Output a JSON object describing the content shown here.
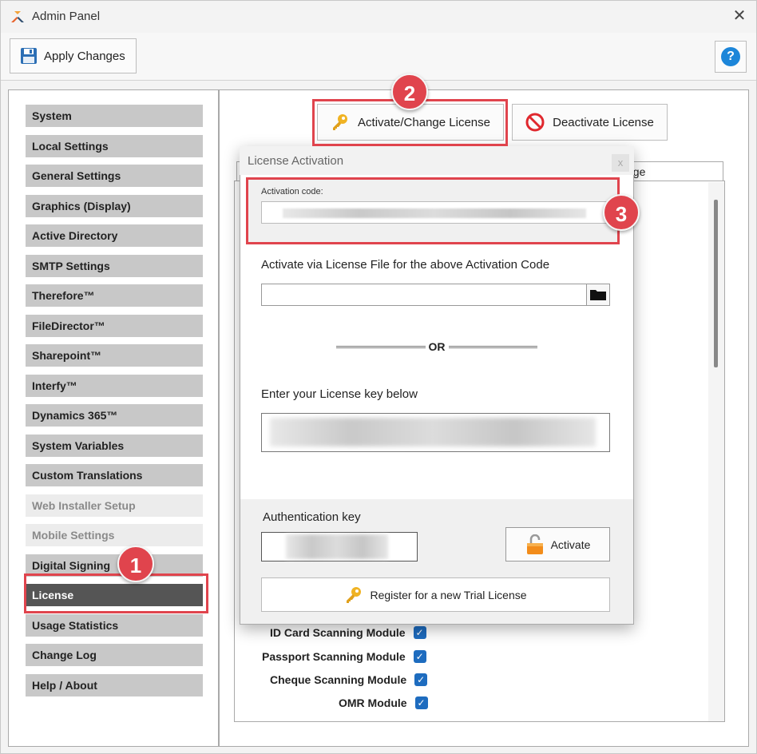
{
  "window": {
    "title": "Admin Panel",
    "close_glyph": "✕"
  },
  "toolbar": {
    "apply_label": "Apply Changes",
    "help_glyph": "?"
  },
  "sidebar": {
    "items": [
      {
        "label": "System",
        "state": "normal"
      },
      {
        "label": "Local Settings",
        "state": "normal"
      },
      {
        "label": "General Settings",
        "state": "normal"
      },
      {
        "label": "Graphics (Display)",
        "state": "normal"
      },
      {
        "label": "Active Directory",
        "state": "normal"
      },
      {
        "label": "SMTP Settings",
        "state": "normal"
      },
      {
        "label": "Therefore™",
        "state": "normal"
      },
      {
        "label": "FileDirector™",
        "state": "normal"
      },
      {
        "label": "Sharepoint™",
        "state": "normal"
      },
      {
        "label": "Interfy™",
        "state": "normal"
      },
      {
        "label": "Dynamics 365™",
        "state": "normal"
      },
      {
        "label": "System Variables",
        "state": "normal"
      },
      {
        "label": "Custom Translations",
        "state": "normal"
      },
      {
        "label": "Web Installer Setup",
        "state": "disabled"
      },
      {
        "label": "Mobile Settings",
        "state": "disabled"
      },
      {
        "label": "Digital Signing",
        "state": "normal"
      },
      {
        "label": "License",
        "state": "active"
      },
      {
        "label": "Usage Statistics",
        "state": "normal"
      },
      {
        "label": "Change Log",
        "state": "normal"
      },
      {
        "label": "Help / About",
        "state": "normal"
      }
    ]
  },
  "license_page": {
    "activate_label": "Activate/Change License",
    "deactivate_label": "Deactivate License",
    "list_header_partial": "age",
    "modules": [
      {
        "label": "ID Card Scanning Module",
        "checked": true
      },
      {
        "label": "Passport Scanning Module",
        "checked": true
      },
      {
        "label": "Cheque Scanning Module",
        "checked": true
      },
      {
        "label": "OMR Module",
        "checked": true
      }
    ]
  },
  "badges": {
    "step1": "1",
    "step2": "2",
    "step3": "3"
  },
  "dialog": {
    "title": "License Activation",
    "close_glyph": "x",
    "activation_code_label": "Activation code:",
    "license_file_label": "Activate via License File for the above Activation Code",
    "or_text": "OR",
    "license_key_label": "Enter your License key below",
    "auth_key_label": "Authentication key",
    "activate_label": "Activate",
    "trial_label": "Register for a new Trial License"
  },
  "colors": {
    "annotation_red": "#e0444d",
    "active_menu": "#555555",
    "menu_bg": "#c8c8c8",
    "checkbox_blue": "#1e6cbf"
  },
  "icons": [
    "app-logo-icon",
    "save-icon",
    "help-icon",
    "key-icon",
    "no-entry-icon",
    "folder-icon",
    "unlock-icon"
  ]
}
